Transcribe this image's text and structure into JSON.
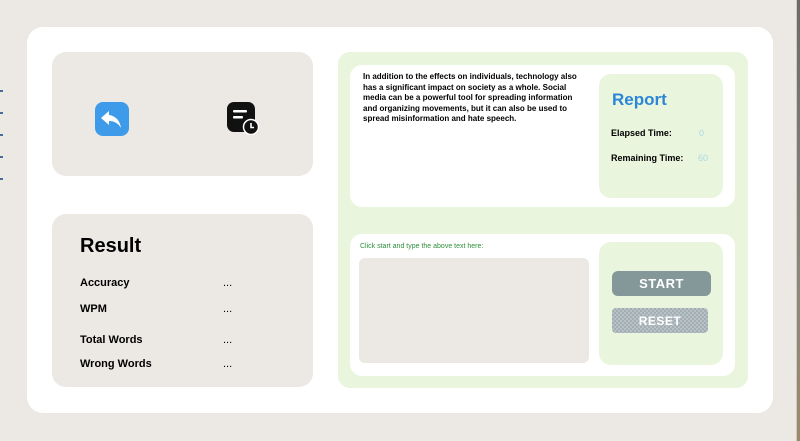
{
  "icons": {
    "back": "undo-arrow-icon",
    "history": "history-clock-icon"
  },
  "result": {
    "title": "Result",
    "stats": [
      {
        "label": "Accuracy",
        "value": "..."
      },
      {
        "label": "WPM",
        "value": "..."
      },
      {
        "label": "Total Words",
        "value": "..."
      },
      {
        "label": "Wrong Words",
        "value": "..."
      }
    ]
  },
  "passage": {
    "text": "In addition to the effects on individuals, technology also has a significant impact on society as a whole. Social media can be a powerful tool for spreading information and organizing movements, but it can also be used to spread misinformation and hate speech."
  },
  "report": {
    "title": "Report",
    "elapsed_label": "Elapsed Time:",
    "elapsed_value": "0",
    "remaining_label": "Remaining Time:",
    "remaining_value": "60"
  },
  "input": {
    "prompt": "Click start and type the above text here:",
    "value": ""
  },
  "controls": {
    "start_label": "START",
    "reset_label": "RESET"
  },
  "colors": {
    "accent_blue": "#2a87d8",
    "panel_green": "#eaf5dd",
    "panel_gray": "#ece8e4",
    "start_button": "#84989a"
  }
}
